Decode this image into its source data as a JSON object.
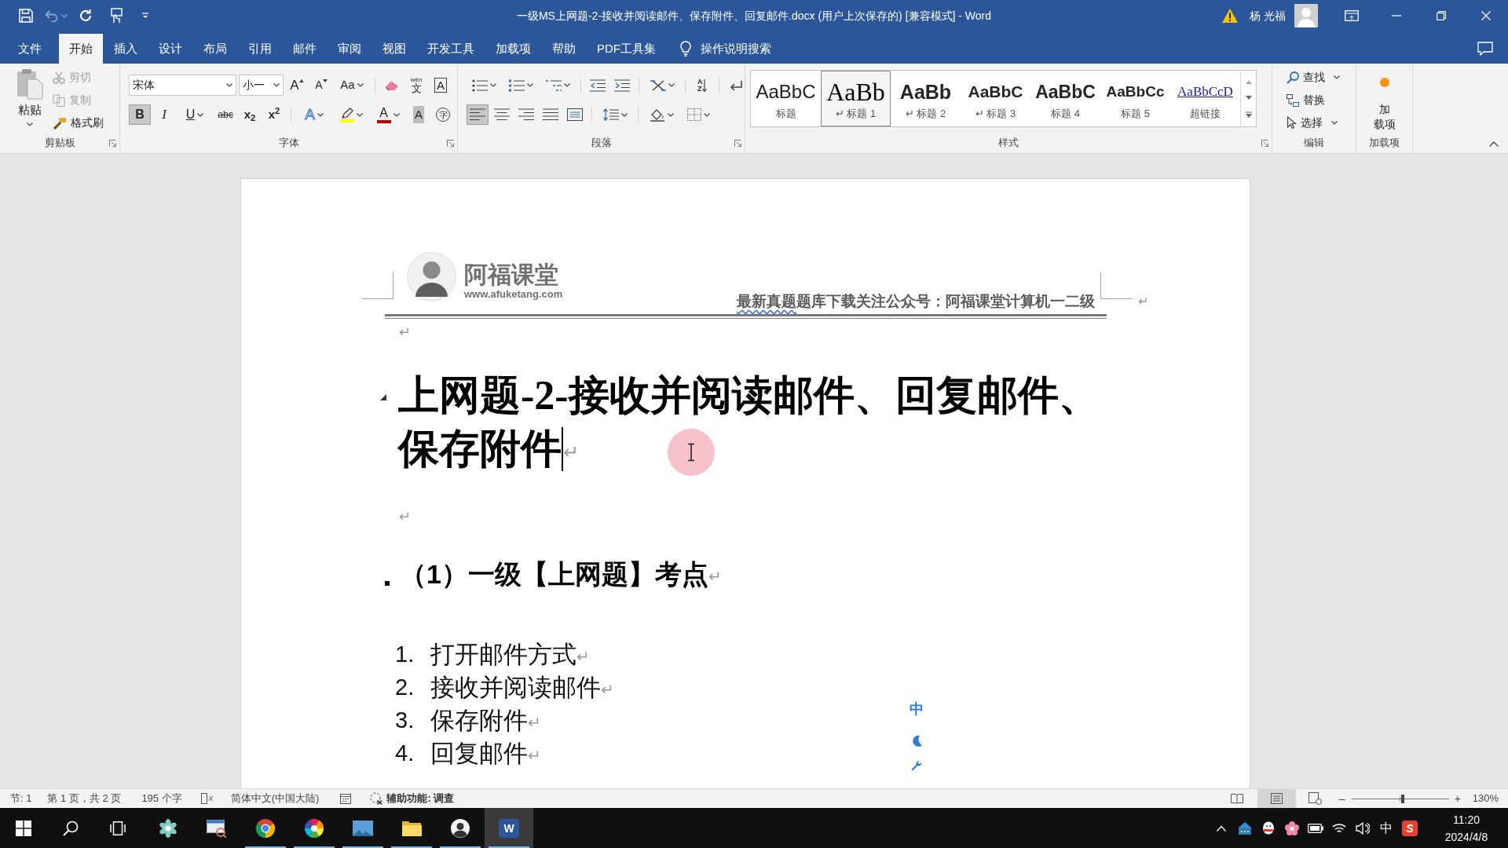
{
  "title_bar": {
    "quick_access": [
      {
        "kind": "save",
        "disabled": false
      },
      {
        "kind": "undo",
        "disabled": true
      },
      {
        "kind": "repeat",
        "disabled": false
      },
      {
        "kind": "touch",
        "disabled": false
      },
      {
        "kind": "customize",
        "disabled": false
      }
    ],
    "title": "一级MS上网题-2-接收并阅读邮件、保存附件、回复邮件.docx (用户上次保存的) [兼容模式] - Word",
    "user_name": "杨 光福"
  },
  "ribbon_tabs": [
    {
      "label": "文件",
      "selected": false
    },
    {
      "label": "开始",
      "selected": true
    },
    {
      "label": "插入",
      "selected": false
    },
    {
      "label": "设计",
      "selected": false
    },
    {
      "label": "布局",
      "selected": false
    },
    {
      "label": "引用",
      "selected": false
    },
    {
      "label": "邮件",
      "selected": false
    },
    {
      "label": "审阅",
      "selected": false
    },
    {
      "label": "视图",
      "selected": false
    },
    {
      "label": "开发工具",
      "selected": false
    },
    {
      "label": "加载项",
      "selected": false
    },
    {
      "label": "帮助",
      "selected": false
    },
    {
      "label": "PDF工具集",
      "selected": false
    }
  ],
  "tell_me": {
    "placeholder": "操作说明搜索"
  },
  "clipboard": {
    "label": "剪贴板",
    "paste": "粘贴",
    "commands": [
      {
        "kind": "cut",
        "label": "剪切",
        "disabled": true
      },
      {
        "kind": "copy",
        "label": "复制",
        "disabled": true
      },
      {
        "kind": "format_painter",
        "label": "格式刷",
        "disabled": false
      }
    ]
  },
  "font": {
    "label": "字体",
    "font_name": "宋体",
    "font_size": "小一",
    "row_1": [
      {
        "kind": "grow",
        "glyph": "A",
        "on": false,
        "dropdown": false
      },
      {
        "kind": "shrink",
        "glyph": "A",
        "on": false,
        "dropdown": false
      },
      {
        "kind": "change_case",
        "glyph": "Aa",
        "on": false,
        "dropdown": true
      },
      {
        "kind": "clear_formatting",
        "on": false,
        "dropdown": false
      },
      {
        "kind": "phonetic",
        "glyph": "文",
        "ruby": "wén",
        "on": false,
        "dropdown": false
      },
      {
        "kind": "char_border",
        "glyph": "A",
        "on": false,
        "dropdown": false
      }
    ],
    "row_2": [
      {
        "kind": "bold",
        "glyph": "B",
        "on": true,
        "dropdown": false
      },
      {
        "kind": "italic",
        "glyph": "I",
        "on": false,
        "dropdown": false
      },
      {
        "kind": "underline",
        "glyph": "U",
        "on": false,
        "dropdown": true
      },
      {
        "kind": "strikethrough",
        "glyph": "abc",
        "on": false,
        "dropdown": false
      },
      {
        "kind": "subscript",
        "glyph": "x$_{2}$",
        "on": false,
        "dropdown": false
      },
      {
        "kind": "superscript",
        "glyph": "x$^{2}$",
        "on": false,
        "dropdown": false
      },
      {
        "kind": "text_effects",
        "glyph": "A",
        "on": false,
        "dropdown": true
      },
      {
        "kind": "highlight",
        "color": "#ffff00",
        "on": false,
        "dropdown": true
      },
      {
        "kind": "font_color",
        "glyph": "A",
        "color": "#c00000",
        "on": false,
        "dropdown": true
      },
      {
        "kind": "char_shading",
        "glyph": "A",
        "on": false,
        "dropdown": false
      },
      {
        "kind": "enclose",
        "glyph": "字",
        "on": false,
        "dropdown": false
      }
    ]
  },
  "paragraph": {
    "label": "段落",
    "row_1": [
      {
        "kind": "bullets",
        "on": false,
        "dropdown": true
      },
      {
        "kind": "numbering",
        "on": false,
        "dropdown": true
      },
      {
        "kind": "multilevel",
        "on": false,
        "dropdown": true
      },
      {
        "kind": "decrease_indent",
        "on": false,
        "dropdown": false
      },
      {
        "kind": "increase_indent",
        "on": false,
        "dropdown": false
      },
      {
        "kind": "asian_layout",
        "on": false,
        "dropdown": true
      },
      {
        "kind": "sort",
        "glyph": "AZ",
        "on": false,
        "dropdown": false
      },
      {
        "kind": "show_marks",
        "on": false,
        "dropdown": false
      }
    ],
    "row_2": [
      {
        "kind": "align_left",
        "on": true,
        "dropdown": false
      },
      {
        "kind": "align_center",
        "on": false,
        "dropdown": false
      },
      {
        "kind": "align_right",
        "on": false,
        "dropdown": false
      },
      {
        "kind": "justify",
        "on": false,
        "dropdown": false
      },
      {
        "kind": "distributed",
        "on": false,
        "dropdown": false
      },
      {
        "kind": "line_spacing",
        "on": false,
        "dropdown": true
      },
      {
        "kind": "shading",
        "on": false,
        "dropdown": true
      },
      {
        "kind": "borders",
        "on": false,
        "dropdown": true
      }
    ]
  },
  "styles": {
    "label": "样式",
    "items": [
      {
        "kind": "title",
        "preview": "AaBbC",
        "label": "标题",
        "selected": false
      },
      {
        "kind": "heading_1",
        "preview": "AaBb",
        "label": "↵ 标题 1",
        "selected": true
      },
      {
        "kind": "heading_2",
        "preview": "AaBb",
        "label": "↵ 标题 2",
        "selected": false
      },
      {
        "kind": "heading_3",
        "preview": "AaBbC",
        "label": "↵ 标题 3",
        "selected": false
      },
      {
        "kind": "heading_4",
        "preview": "AaBbC",
        "label": "标题 4",
        "selected": false
      },
      {
        "kind": "heading_5",
        "preview": "AaBbCc",
        "label": "标题 5",
        "selected": false
      },
      {
        "kind": "hyperlink",
        "preview": "AaBbCcD",
        "label": "超链接",
        "selected": false
      }
    ]
  },
  "editing": {
    "label": "编辑",
    "commands": [
      {
        "kind": "find",
        "label": "查找",
        "dropdown": true
      },
      {
        "kind": "replace",
        "label": "替换",
        "dropdown": false
      },
      {
        "kind": "select",
        "label": "选择",
        "dropdown": true
      }
    ]
  },
  "add_ins": {
    "button_lines": [
      "加",
      "载项"
    ],
    "label": "加载项"
  },
  "document": {
    "header": {
      "logo_name": "阿福课堂",
      "logo_url": "www.afuketang.com",
      "notice": [
        {
          "text": "最新真题",
          "flagged": true
        },
        {
          "text": "题库下载关注公众号：阿福课堂计算机一二级",
          "flagged": false
        }
      ],
      "mark": "↵"
    },
    "paragraphs": [
      {
        "kind": "empty",
        "caret": false,
        "mark": "↵"
      },
      {
        "kind": "heading_1",
        "lines": [
          "上网题-2-接收并阅读邮件、回复邮件、",
          "保存附件"
        ],
        "caret": true,
        "mark": "↵"
      },
      {
        "kind": "empty",
        "caret": false,
        "mark": "↵"
      },
      {
        "kind": "heading_2",
        "text": "（1）一级【上网题】考点",
        "caret": false,
        "mark": "↵"
      },
      {
        "kind": "list_item",
        "number": "1.",
        "text": "打开邮件方式",
        "caret": false,
        "mark": "↵"
      },
      {
        "kind": "list_item",
        "number": "2.",
        "text": "接收并阅读邮件",
        "caret": false,
        "mark": "↵"
      },
      {
        "kind": "list_item",
        "number": "3.",
        "text": "保存附件",
        "caret": false,
        "mark": "↵"
      },
      {
        "kind": "list_item",
        "number": "4.",
        "text": "回复邮件",
        "caret": false,
        "mark": "↵"
      }
    ],
    "ime_toolbar": {
      "mode": "中"
    }
  },
  "status_bar": {
    "items": [
      {
        "kind": "text",
        "label": "节: 1"
      },
      {
        "kind": "text",
        "label": "第 1 页，共 2 页"
      },
      {
        "kind": "text",
        "label": "195 个字"
      },
      {
        "kind": "track_changes"
      },
      {
        "kind": "text",
        "label": "简体中文(中国大陆)"
      },
      {
        "kind": "macro"
      },
      {
        "kind": "accessibility",
        "label": "辅助功能: 调查"
      }
    ],
    "views": [
      {
        "kind": "read",
        "selected": false
      },
      {
        "kind": "print",
        "selected": true
      },
      {
        "kind": "web",
        "selected": false
      }
    ],
    "zoom": {
      "minus": "–",
      "plus": "+",
      "level": 0.53,
      "reading": "130%"
    }
  },
  "taskbar": {
    "system": [
      {
        "kind": "start"
      },
      {
        "kind": "search"
      },
      {
        "kind": "task_view"
      }
    ],
    "apps": [
      {
        "kind": "pinwheel",
        "running": false,
        "selected": false
      },
      {
        "kind": "magnifier",
        "running": false,
        "selected": false
      },
      {
        "kind": "browser",
        "running": true,
        "selected": false
      },
      {
        "kind": "color_wheel",
        "running": true,
        "selected": false
      },
      {
        "kind": "photos",
        "running": true,
        "selected": false
      },
      {
        "kind": "folder",
        "running": true,
        "selected": false
      },
      {
        "kind": "person",
        "running": true,
        "selected": false
      },
      {
        "kind": "word",
        "glyph": "W",
        "running": true,
        "selected": true
      }
    ],
    "tray": [
      {
        "kind": "chevron"
      },
      {
        "kind": "network_box"
      },
      {
        "kind": "mascot"
      },
      {
        "kind": "flower"
      },
      {
        "kind": "battery"
      },
      {
        "kind": "wifi"
      },
      {
        "kind": "volume"
      },
      {
        "kind": "ime",
        "glyph": "中"
      },
      {
        "kind": "sogou",
        "glyph": "S"
      }
    ],
    "time": "11:20",
    "date": "2024/4/8"
  }
}
